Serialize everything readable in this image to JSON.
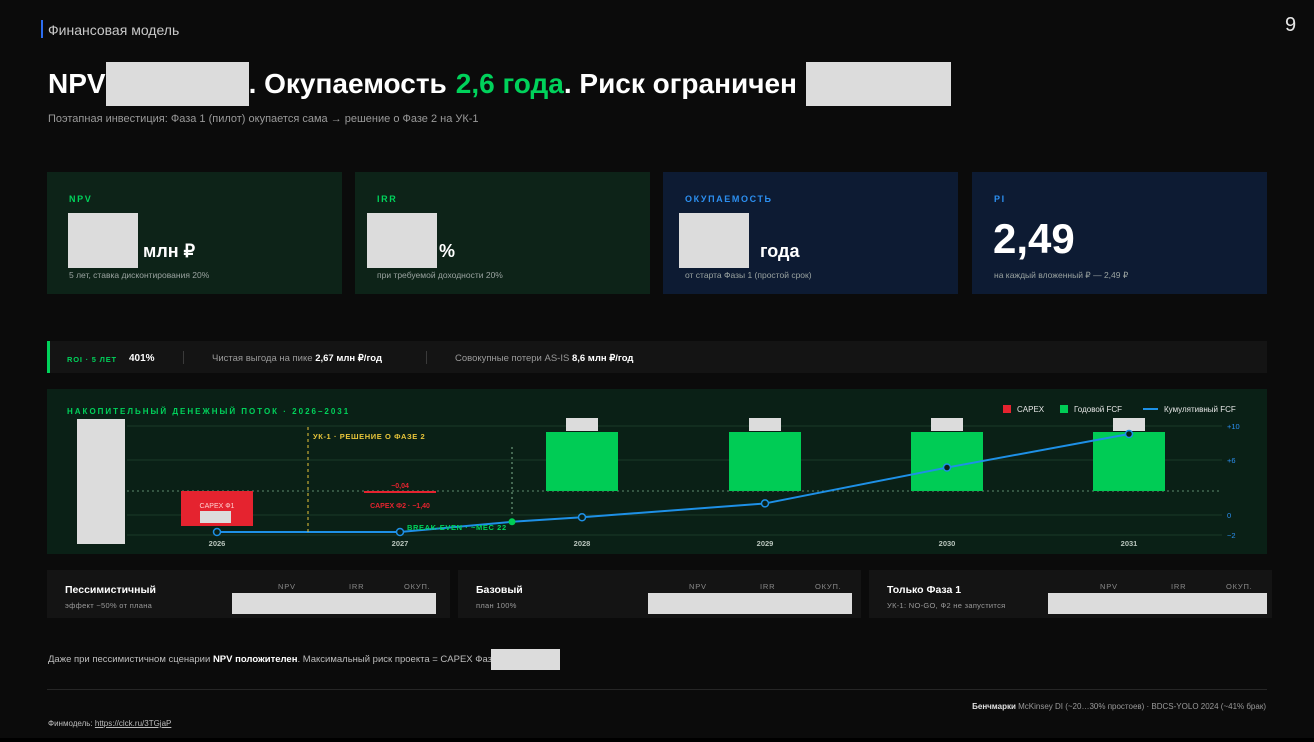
{
  "slide": {
    "section": "Финансовая модель",
    "page": "9"
  },
  "headline": {
    "p1": "NPV",
    "p2": ". Окупаемость",
    "highlight": "2,6 года",
    "p3": ". Риск ограничен"
  },
  "subtitle": "Поэтапная инвестиция: Фаза 1 (пилот) окупается сама → решение о Фазе 2 на УК-1",
  "kpis": [
    {
      "label": "NPV",
      "unit": "млн ₽",
      "note": "5 лет, ставка дисконтирования 20%"
    },
    {
      "label": "IRR",
      "unit": "%",
      "note": "при требуемой доходности 20%"
    },
    {
      "label": "ОКУПАЕМОСТЬ",
      "unit": "года",
      "note": "от старта Фазы 1 (простой срок)"
    },
    {
      "label": "PI",
      "value": "2,49",
      "note": "на каждый вложенный ₽ — 2,49 ₽"
    }
  ],
  "roi": {
    "label": "ROI · 5 ЛЕТ",
    "value": "401%",
    "peak_label": "Чистая выгода на пике",
    "peak_value": "2,67 млн ₽/год",
    "loss_label": "Совокупные потери AS-IS",
    "loss_value": "8,6 млн ₽/год"
  },
  "chart_data": {
    "type": "bar",
    "title": "НАКОПИТЕЛЬНЫЙ ДЕНЕЖНЫЙ ПОТОК · 2026–2031",
    "categories": [
      "2026",
      "2027",
      "2028",
      "2029",
      "2030",
      "2031"
    ],
    "series": [
      {
        "name": "CAPEX",
        "values": [
          -1.5,
          -0.04,
          null,
          null,
          null,
          null
        ],
        "color": "#e5232f"
      },
      {
        "name": "Годовой FCF",
        "values": [
          null,
          null,
          2.67,
          2.67,
          2.67,
          2.67
        ],
        "color": "#00cc55"
      },
      {
        "name": "Кумулятивный FCF",
        "values": [
          -1.5,
          -1.5,
          -0.2,
          1.0,
          4.1,
          7.0
        ],
        "color": "#1e90e6"
      }
    ],
    "bar_labels": [
      "CAPEX Ф1",
      "−0,04",
      "CAPEX Ф2 · −1,40"
    ],
    "annotations": [
      "УК-1 · РЕШЕНИЕ О ФАЗЕ 2",
      "BREAK-EVEN · ~МЕС 22"
    ],
    "yticks": [
      "+10",
      "+6",
      "0",
      "−2"
    ],
    "ylim": [
      -2,
      10
    ],
    "legend": "top-right",
    "grid": true
  },
  "scenarios": [
    {
      "name": "Пессимистичный",
      "desc": "эффект ~50% от плана"
    },
    {
      "name": "Базовый",
      "desc": "план 100%"
    },
    {
      "name": "Только Фаза 1",
      "desc": "УК-1: NO-GO, Ф2 не запустится"
    }
  ],
  "scenario_headers": [
    "NPV",
    "IRR",
    "ОКУП."
  ],
  "footnote": {
    "p1": "Даже при пессимистичном сценарии ",
    "bold": "NPV положителен",
    "p2": ". Максимальный риск проекта = CAPEX Фазы 1 ="
  },
  "bench": {
    "bold": "Бенчмарки",
    "text": " McKinsey DI (~20…30% простоев) · BDCS-YOLO 2024 (~41% брак)"
  },
  "finmodel": {
    "label": "Финмодель:",
    "link": "https://clck.ru/3TGjaP"
  },
  "colors": {
    "green": "#00d25b",
    "blue": "#2c8ff0",
    "red": "#e5232f",
    "yellow": "#e8c53a"
  }
}
